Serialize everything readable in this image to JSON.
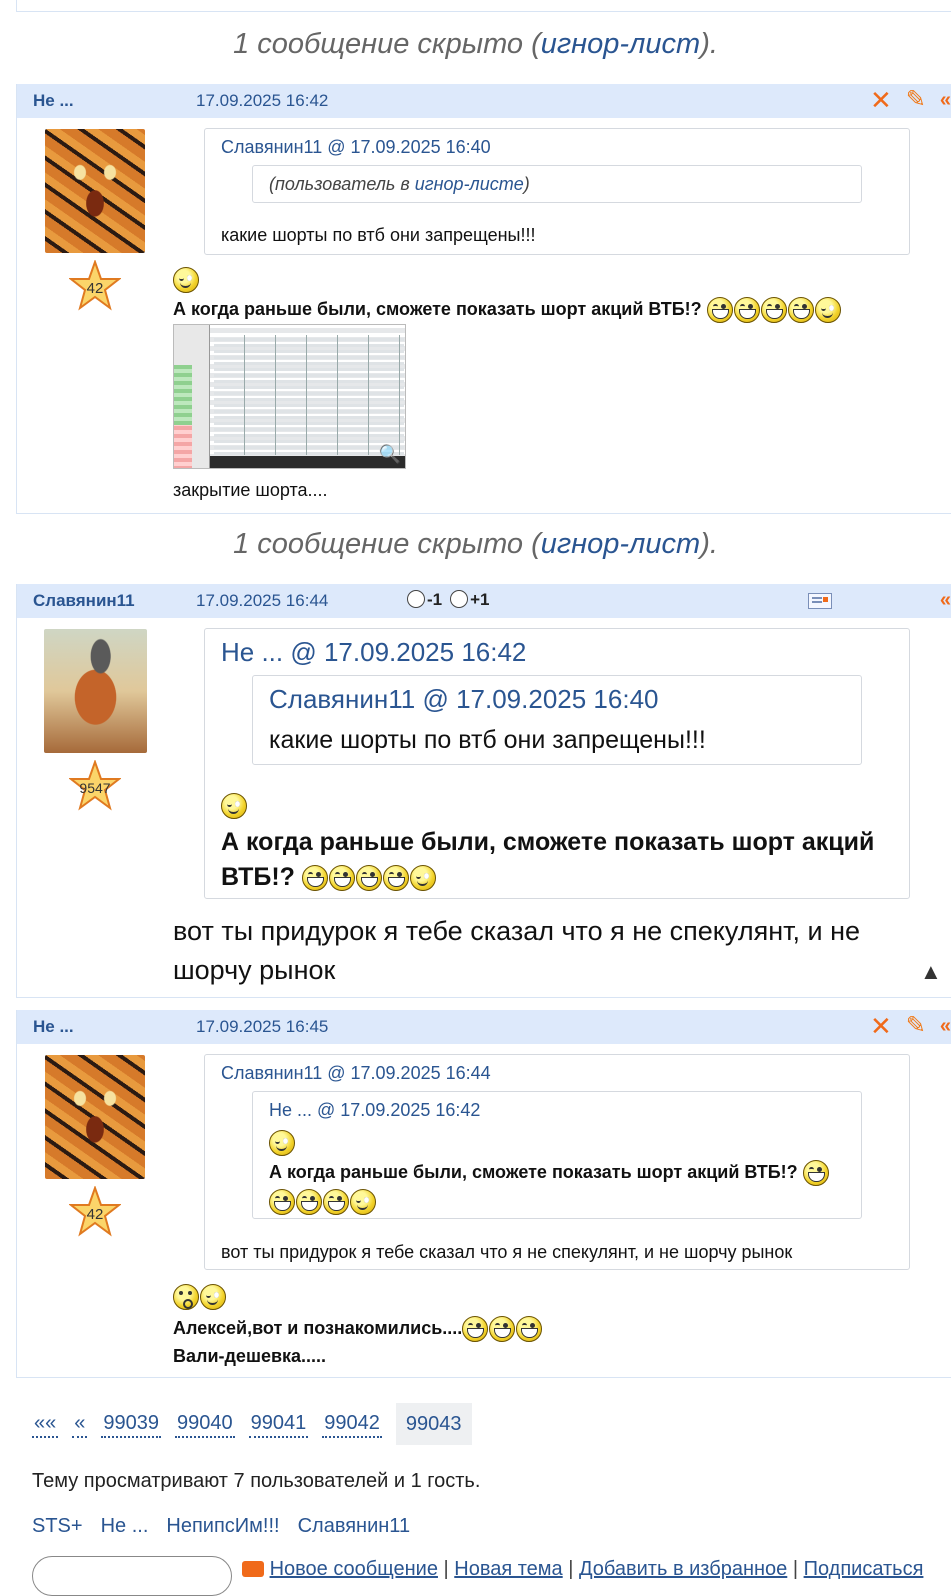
{
  "hidden_note_1": {
    "prefix": "1 сообщение скрыто (",
    "link": "игнор-лист",
    "suffix": ")."
  },
  "hidden_note_2": {
    "prefix": "1 сообщение скрыто (",
    "link": "игнор-лист",
    "suffix": ")."
  },
  "post1": {
    "author": "Не ...",
    "date": "17.09.2025 16:42",
    "rating": "42",
    "quote": {
      "source": "Славянин11 @ 17.09.2025 16:40",
      "inner_prefix": "(пользователь в ",
      "inner_link": "игнор-листе",
      "inner_suffix": ")",
      "text": "какие шорты по втб они запрещены!!!"
    },
    "bold_text": "А когда раньше были, сможете показать шорт акций ВТБ!?",
    "caption": "закрытие шорта...."
  },
  "post2": {
    "author": "Славянин11",
    "date": "17.09.2025 16:44",
    "vote_minus": "-1",
    "vote_plus": "+1",
    "rating": "9547",
    "quote": {
      "source": "Не ... @ 17.09.2025 16:42",
      "inner_source": "Славянин11 @ 17.09.2025 16:40",
      "inner_text": "какие шорты по втб они запрещены!!!",
      "bold_text_1": "А когда раньше были, сможете показать шорт акций",
      "bold_text_2": "ВТБ!?"
    },
    "text_1": "вот ты придурок я тебе сказал что я не спекулянт, и не",
    "text_2": "шорчу рынок"
  },
  "post3": {
    "author": "Не ...",
    "date": "17.09.2025 16:45",
    "rating": "42",
    "quote": {
      "source": "Славянин11 @ 17.09.2025 16:44",
      "inner_source": "Не ... @ 17.09.2025 16:42",
      "inner_bold": "А когда раньше были, сможете показать шорт акций ВТБ!?",
      "text": "вот ты придурок я тебе сказал что я не спекулянт, и не шорчу рынок"
    },
    "line_1": "Алексей,вот и познакомились....",
    "line_2": "Вали-дешевка....."
  },
  "pager": {
    "first": "««",
    "prev": "«",
    "pages": [
      "99039",
      "99040",
      "99041",
      "99042",
      "99043"
    ],
    "current": "99043"
  },
  "viewers": {
    "summary": "Тему просматривают 7 пользователей и 1 гость.",
    "users": [
      "STS+",
      "Не ...",
      "НепипсИм!!!",
      "Славянин11"
    ]
  },
  "bottom": {
    "new_message": "Новое сообщение",
    "new_topic": "Новая тема",
    "add_favorites": "Добавить в избранное",
    "subscribe": "Подписаться"
  },
  "colors": {
    "link": "#2a5591",
    "header_bg": "#dde9fb",
    "action": "#f06a1a"
  }
}
